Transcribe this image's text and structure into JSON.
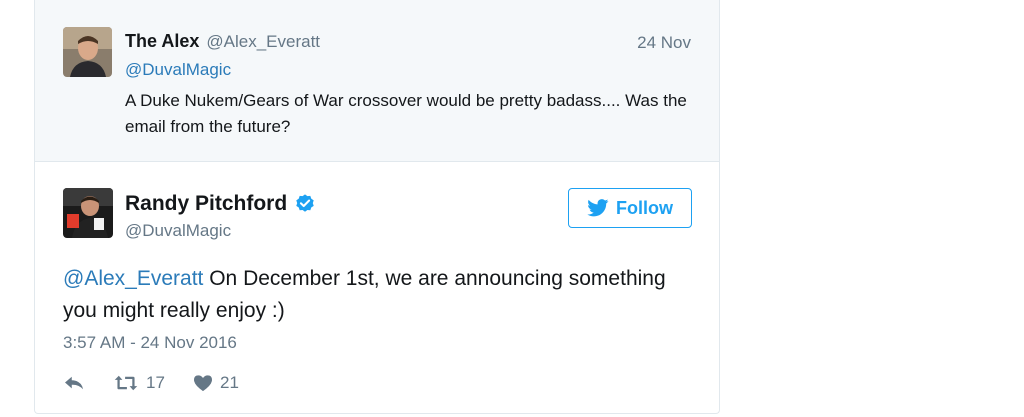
{
  "parent_tweet": {
    "author_name": "The Alex",
    "author_handle": "@Alex_Everatt",
    "date": "24 Nov",
    "reply_to": "@DuvalMagic",
    "text": "A Duke Nukem/Gears of War crossover would be pretty badass.... Was the email from the future?"
  },
  "main_tweet": {
    "author_name": "Randy Pitchford",
    "author_handle": "@DuvalMagic",
    "verified": true,
    "follow_label": "Follow",
    "mention": "@Alex_Everatt",
    "text": " On December 1st, we are announcing something you might really enjoy :)",
    "timestamp": "3:57 AM - 24 Nov 2016",
    "retweet_count": "17",
    "like_count": "21"
  },
  "icons": {
    "verified": "verified-badge-icon",
    "follow": "twitter-bird-icon",
    "reply": "reply-icon",
    "retweet": "retweet-icon",
    "like": "heart-icon"
  },
  "colors": {
    "link": "#2b7bb9",
    "brand": "#1da1f2",
    "muted": "#657786",
    "parent_bg": "#f5f8fa",
    "border": "#e1e8ed"
  }
}
